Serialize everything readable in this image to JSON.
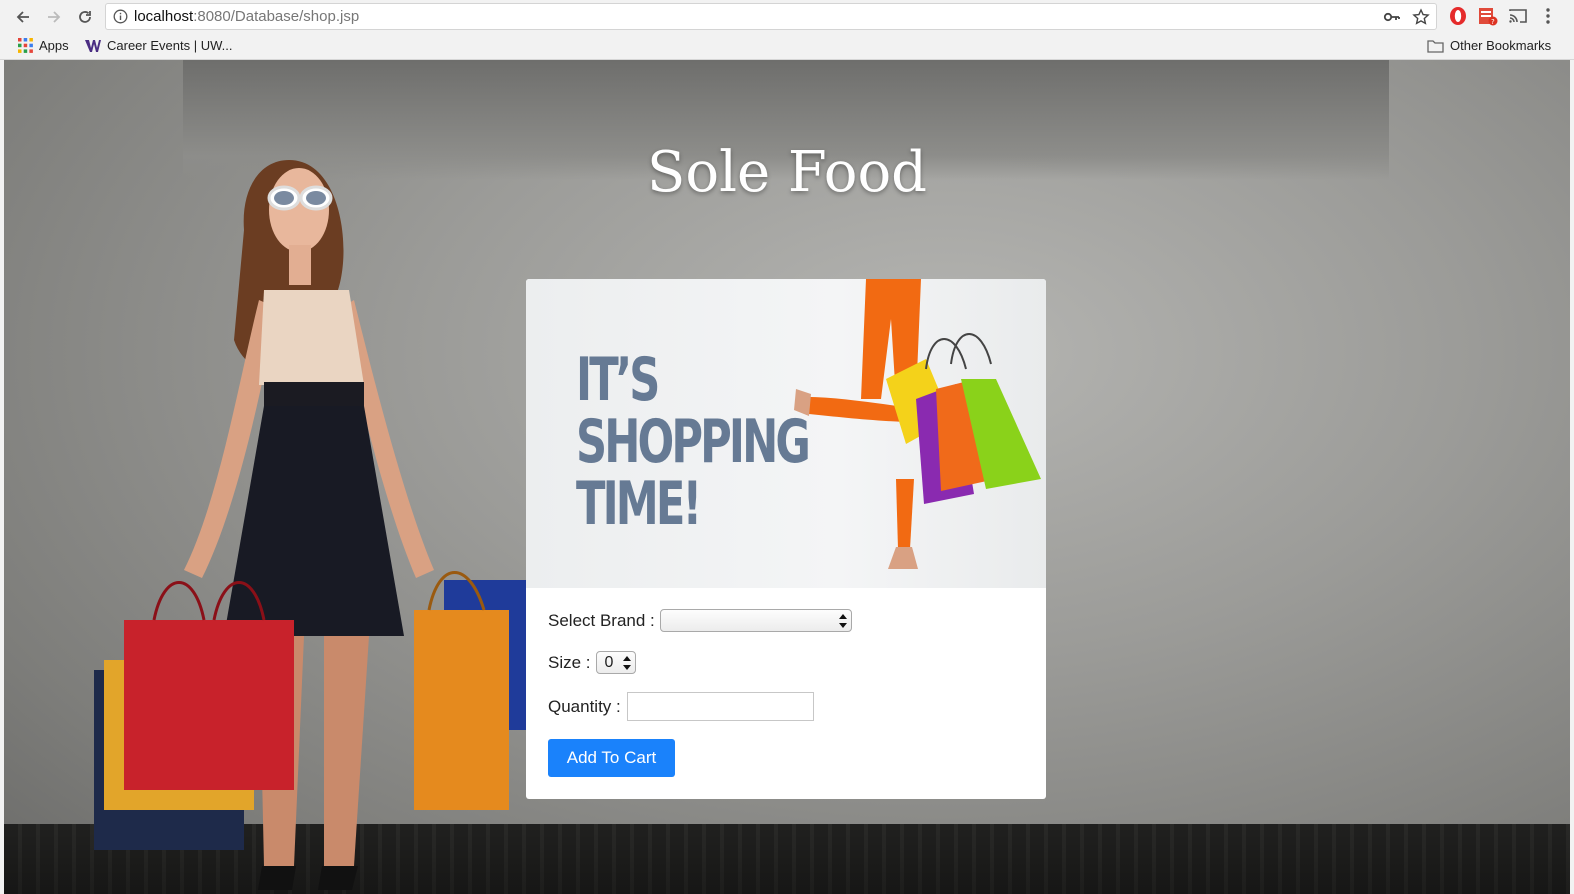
{
  "browser": {
    "url_host": "localhost",
    "url_path": ":8080/Database/shop.jsp",
    "bookmarks": [
      {
        "label": "Apps"
      },
      {
        "label": "Career Events | UW..."
      }
    ],
    "other_bookmarks": "Other Bookmarks"
  },
  "page": {
    "site_title": "Sole Food",
    "hero_lines": [
      "IT’S",
      "SHOPPING",
      "TIME!"
    ],
    "form": {
      "brand_label": "Select Brand :",
      "brand_value": "",
      "size_label": "Size :",
      "size_value": "0",
      "quantity_label": "Quantity :",
      "quantity_value": "",
      "submit_label": "Add To Cart"
    }
  },
  "colors": {
    "button": "#1a82fb",
    "hero_text": "#667a94"
  }
}
